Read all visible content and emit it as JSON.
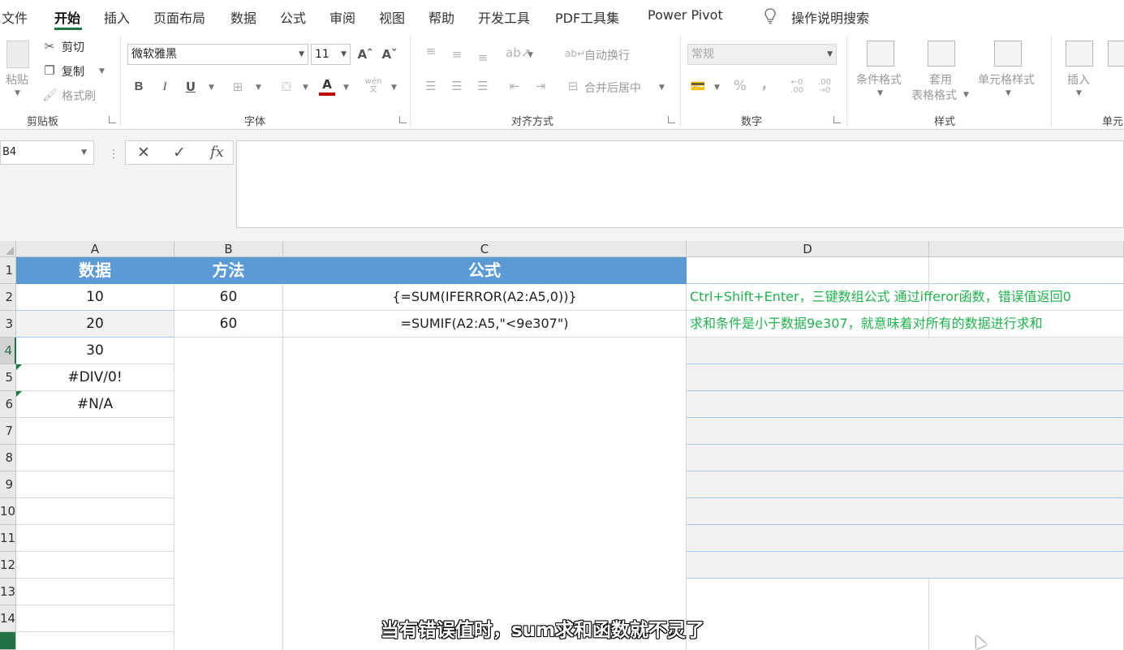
{
  "menu": {
    "items": [
      "文件",
      "开始",
      "插入",
      "页面布局",
      "数据",
      "公式",
      "审阅",
      "视图",
      "帮助",
      "开发工具",
      "PDF工具集",
      "Power Pivot"
    ],
    "active": "开始",
    "search_label": "操作说明搜索"
  },
  "clipboard": {
    "paste": "粘贴",
    "cut": "剪切",
    "copy": "复制",
    "format_painter": "格式刷",
    "label": "剪贴板"
  },
  "font": {
    "name": "微软雅黑",
    "size": "11",
    "bold": "B",
    "italic": "I",
    "underline": "U",
    "label": "字体",
    "phonetic": "wén"
  },
  "alignment": {
    "wrap_text": "自动换行",
    "merge_center": "合并后居中",
    "label": "对齐方式"
  },
  "number": {
    "format": "常规",
    "percent": "%",
    "comma": ",",
    "label": "数字"
  },
  "styles": {
    "conditional_formatting": "条件格式",
    "format_as_table_1": "套用",
    "format_as_table_2": "表格格式",
    "cell_styles": "单元格样式",
    "label": "样式"
  },
  "cells_group": {
    "insert": "插入",
    "label": "单元"
  },
  "formula_bar": {
    "name_box": "B4",
    "cancel": "✕",
    "enter": "✓",
    "fx": "fx",
    "content": ""
  },
  "columns": [
    "A",
    "B",
    "C",
    "D"
  ],
  "rows": [
    "1",
    "2",
    "3",
    "4",
    "5",
    "6",
    "7",
    "8",
    "9",
    "10",
    "11",
    "12",
    "13",
    "14"
  ],
  "sheet": {
    "header": {
      "a": "数据",
      "b": "方法",
      "c": "公式"
    },
    "a": [
      "10",
      "20",
      "30",
      "#DIV/0!",
      "#N/A"
    ],
    "b": [
      "60",
      "60"
    ],
    "c": [
      "{=SUM(IFERROR(A2:A5,0))}",
      "=SUMIF(A2:A5,\"<9e307\")"
    ],
    "d": [
      "Ctrl+Shift+Enter，三键数组公式      通过ifferor函数，错误值返回0",
      "求和条件是小于数据9e307，就意味着对所有的数据进行求和"
    ]
  },
  "subtitle": "当有错误值时，sum求和函数就不灵了",
  "colors": {
    "header_fill": "#5b9bd5",
    "note_text": "#21b24d",
    "excel_green": "#217346"
  }
}
